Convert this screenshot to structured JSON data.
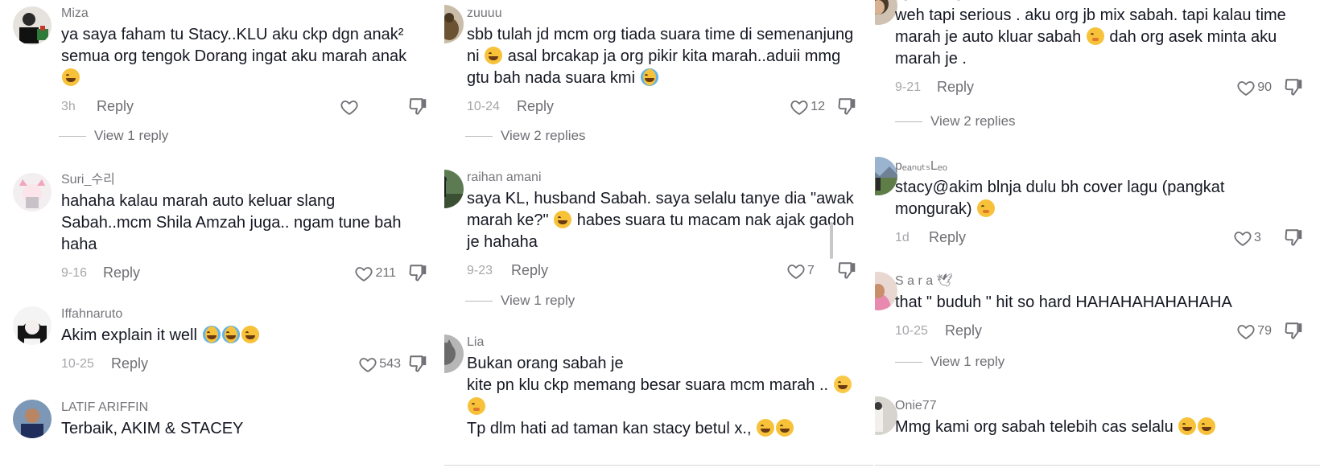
{
  "reply_label": "Reply",
  "column1": [
    {
      "username": "Miza",
      "text": "ya saya faham tu Stacy..KLU aku ckp dgn anak² semua org tengok Dorang ingat aku marah anak",
      "emojis": [
        "laugh-tears"
      ],
      "date": "3h",
      "likes": "",
      "view_replies": "View 1 reply"
    },
    {
      "username": "Suri_수리",
      "text": "hahaha kalau marah auto keluar slang Sabah..mcm Shila Amzah juga.. ngam tune bah haha",
      "emojis": [],
      "date": "9-16",
      "likes": "211",
      "view_replies": ""
    },
    {
      "username": "Iffahnaruto",
      "text": "Akim explain it well",
      "emojis": [
        "crying",
        "crying",
        "rofl"
      ],
      "date": "10-25",
      "likes": "543",
      "view_replies": ""
    },
    {
      "username": "LATIF ARIFFIN",
      "text": "Terbaik, AKIM & STACEY",
      "emojis": [],
      "date": "",
      "likes": "",
      "view_replies": ""
    }
  ],
  "column2": [
    {
      "username": "zuuuu",
      "text_a": "sbb tulah jd mcm org tiada suara time di semenanjung ni",
      "text_b": "asal brcakap ja org pikir kita marah..aduii mmg gtu bah nada suara kmi",
      "emojis": [
        "laugh-tears",
        "crying"
      ],
      "date": "10-24",
      "likes": "12",
      "view_replies": "View 2 replies"
    },
    {
      "username": "raihan amani",
      "text_a": "saya KL, husband Sabah. saya selalu tanye dia \"awak marah ke?\"",
      "text_b": "habes suara tu macam nak ajak gadoh je hahaha",
      "emojis": [
        "laugh-tears"
      ],
      "date": "9-23",
      "likes": "7",
      "view_replies": "View 1 reply"
    },
    {
      "username": "Lia",
      "line1": "Bukan orang sabah je",
      "line2": "kite pn klu ckp memang besar suara mcm marah ..",
      "line3": "Tp dlm hati ad taman kan stacy betul x.,",
      "emojis": [
        "grin",
        "hush",
        "laugh-tears",
        "rofl"
      ]
    }
  ],
  "column3": [
    {
      "username": "agustinarage",
      "text_a": "weh tapi serious . aku org jb mix sabah. tapi kalau time marah je auto kluar sabah",
      "text_b": "dah org asek minta aku marah je .",
      "emojis": [
        "hush"
      ],
      "date": "9-21",
      "likes": "90",
      "view_replies": "View 2 replies"
    },
    {
      "username": "pₑₐₙᵤₜₛLₑₒ",
      "text": "stacy@akim blnja dulu bh cover lagu (pangkat mongurak)",
      "emojis": [
        "hush"
      ],
      "date": "1d",
      "likes": "3",
      "view_replies": ""
    },
    {
      "username": "S a r a 🕊",
      "text": "that \" buduh \" hit so hard HAHAHAHAHAHAHA",
      "emojis": [],
      "date": "10-25",
      "likes": "79",
      "view_replies": "View 1 reply"
    },
    {
      "username": "Onie77",
      "text": "Mmg kami org sabah telebih cas selalu",
      "emojis": [
        "laugh-tears",
        "laugh-tears"
      ]
    }
  ]
}
